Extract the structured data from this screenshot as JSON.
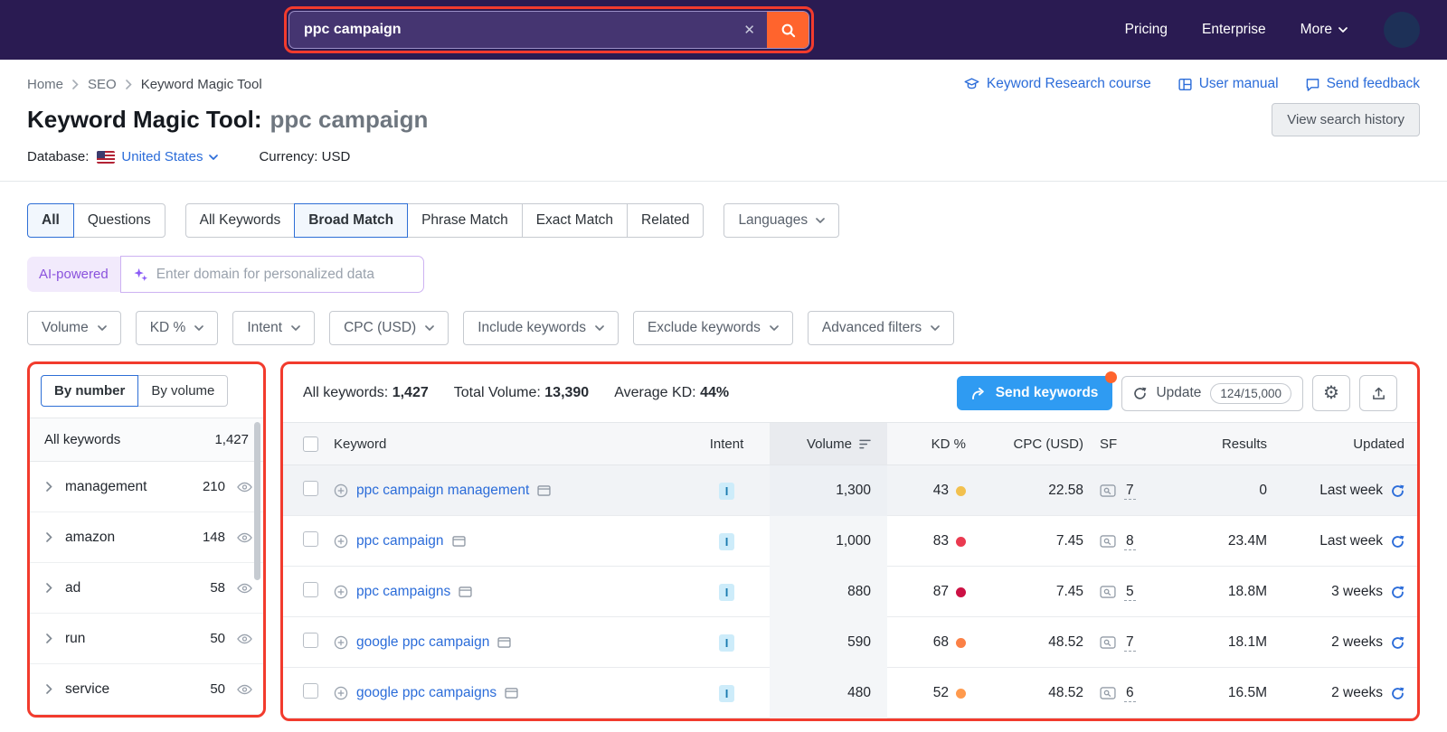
{
  "colors": {
    "annotation_red": "#f23b2d",
    "accent_orange": "#ff642d",
    "link_blue": "#2b6cd9",
    "send_button_blue": "#2f9bf2",
    "header_purple": "#2a1b52"
  },
  "header": {
    "search": {
      "value": "ppc campaign"
    },
    "nav": [
      {
        "label": "Pricing"
      },
      {
        "label": "Enterprise"
      },
      {
        "label": "More"
      }
    ]
  },
  "breadcrumb": [
    "Home",
    "SEO",
    "Keyword Magic Tool"
  ],
  "help_links": [
    {
      "label": "Keyword Research course",
      "icon": "graduation-cap-icon"
    },
    {
      "label": "User manual",
      "icon": "book-icon"
    },
    {
      "label": "Send feedback",
      "icon": "feedback-bubble-icon"
    }
  ],
  "title": {
    "label": "Keyword Magic Tool:",
    "query": "ppc campaign"
  },
  "buttons": {
    "view_history": "View search history"
  },
  "database": {
    "label": "Database:",
    "country": "United States",
    "currency": "Currency: USD"
  },
  "tabs": {
    "scope": [
      "All",
      "Questions"
    ],
    "scope_selected": "All",
    "match": [
      "All Keywords",
      "Broad Match",
      "Phrase Match",
      "Exact Match",
      "Related"
    ],
    "match_selected": "Broad Match",
    "languages": "Languages"
  },
  "ai": {
    "badge": "AI-powered",
    "placeholder": "Enter domain for personalized data"
  },
  "filters": [
    "Volume",
    "KD %",
    "Intent",
    "CPC (USD)",
    "Include keywords",
    "Exclude keywords",
    "Advanced filters"
  ],
  "sidebar": {
    "toggle": [
      "By number",
      "By volume"
    ],
    "toggle_selected": "By number",
    "all_label": "All keywords",
    "all_count": "1,427",
    "groups": [
      {
        "label": "management",
        "count": "210"
      },
      {
        "label": "amazon",
        "count": "148"
      },
      {
        "label": "ad",
        "count": "58"
      },
      {
        "label": "run",
        "count": "50"
      },
      {
        "label": "service",
        "count": "50"
      }
    ]
  },
  "summary": {
    "all_label": "All keywords:",
    "all_value": "1,427",
    "volume_label": "Total Volume:",
    "volume_value": "13,390",
    "kd_label": "Average KD:",
    "kd_value": "44%"
  },
  "actions": {
    "send_keywords": "Send keywords",
    "update": "Update",
    "quota": "124/15,000"
  },
  "table": {
    "columns": [
      "Keyword",
      "Intent",
      "Volume",
      "KD %",
      "CPC (USD)",
      "SF",
      "Results",
      "Updated"
    ],
    "rows": [
      {
        "keyword": "ppc campaign management",
        "intent": "I",
        "volume": "1,300",
        "kd": "43",
        "kd_color": "#f2c04e",
        "cpc": "22.58",
        "sf": "7",
        "results": "0",
        "updated": "Last week"
      },
      {
        "keyword": "ppc campaign",
        "intent": "I",
        "volume": "1,000",
        "kd": "83",
        "kd_color": "#ea3a50",
        "cpc": "7.45",
        "sf": "8",
        "results": "23.4M",
        "updated": "Last week"
      },
      {
        "keyword": "ppc campaigns",
        "intent": "I",
        "volume": "880",
        "kd": "87",
        "kd_color": "#cc1144",
        "cpc": "7.45",
        "sf": "5",
        "results": "18.8M",
        "updated": "3 weeks"
      },
      {
        "keyword": "google ppc campaign",
        "intent": "I",
        "volume": "590",
        "kd": "68",
        "kd_color": "#fb8046",
        "cpc": "48.52",
        "sf": "7",
        "results": "18.1M",
        "updated": "2 weeks"
      },
      {
        "keyword": "google ppc campaigns",
        "intent": "I",
        "volume": "480",
        "kd": "52",
        "kd_color": "#ff9a4d",
        "cpc": "48.52",
        "sf": "6",
        "results": "16.5M",
        "updated": "2 weeks"
      }
    ]
  }
}
